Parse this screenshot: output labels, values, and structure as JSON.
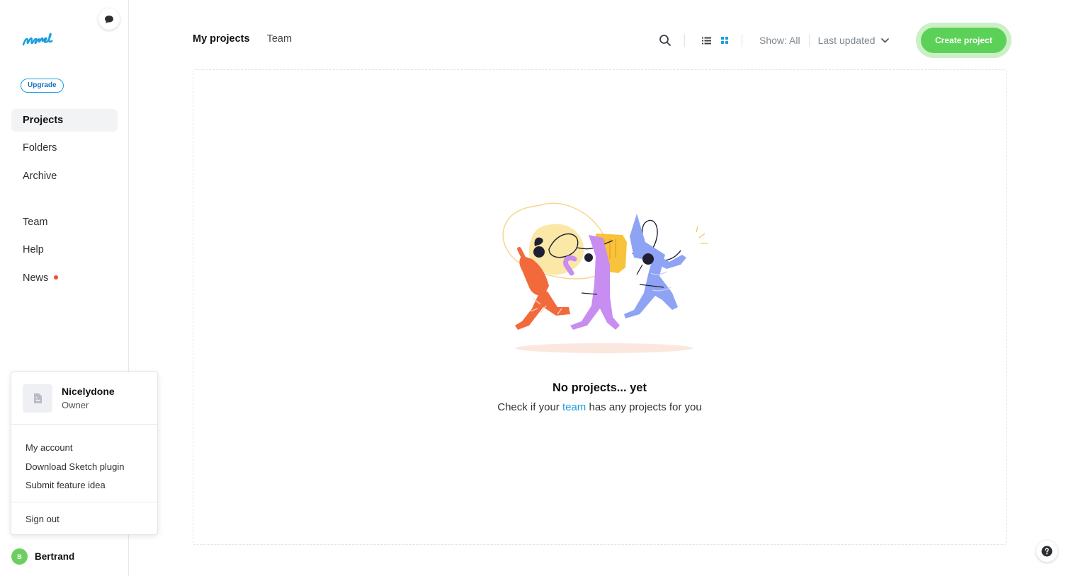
{
  "app": {
    "logo_text": "Marvel",
    "brand_color": "#1b9ee0",
    "accent_green": "#5cd157"
  },
  "sidebar": {
    "upgrade_label": "Upgrade",
    "items": [
      {
        "label": "Projects",
        "active": true
      },
      {
        "label": "Folders",
        "active": false
      },
      {
        "label": "Archive",
        "active": false
      },
      {
        "label": "Team",
        "active": false
      },
      {
        "label": "Help",
        "active": false
      },
      {
        "label": "News",
        "active": false,
        "badge": "red-dot"
      }
    ]
  },
  "account_menu": {
    "name": "Nicelydone",
    "role": "Owner",
    "links": [
      "My account",
      "Download Sketch plugin",
      "Submit feature idea"
    ],
    "signout_label": "Sign out"
  },
  "user": {
    "initial": "B",
    "name": "Bertrand"
  },
  "header": {
    "tabs": [
      {
        "label": "My projects",
        "active": true
      },
      {
        "label": "Team",
        "active": false
      }
    ],
    "show_filter": "Show: All",
    "sort_label": "Last updated",
    "view_mode": "grid",
    "create_label": "Create project"
  },
  "empty_state": {
    "title": "No projects... yet",
    "sub_prefix": "Check if your ",
    "sub_link": "team",
    "sub_suffix": " has any projects for you"
  }
}
